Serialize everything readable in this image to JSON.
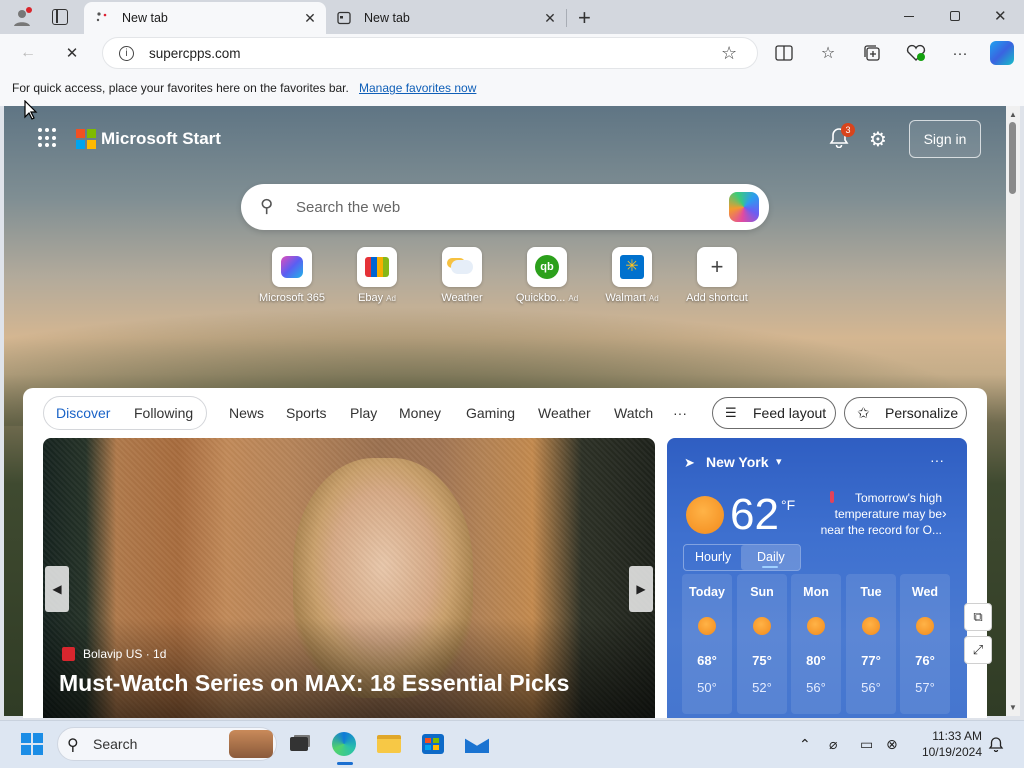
{
  "browser": {
    "tabs": [
      {
        "title": "New tab",
        "active": true
      },
      {
        "title": "New tab",
        "active": false
      }
    ],
    "address": "supercpps.com",
    "favorites_message": "For quick access, place your favorites here on the favorites bar.",
    "favorites_link": "Manage favorites now"
  },
  "start": {
    "brand": "Microsoft Start",
    "notification_count": "3",
    "sign_in": "Sign in",
    "search_placeholder": "Search the web",
    "shortcuts": [
      {
        "label": "Microsoft 365",
        "ad": "",
        "icon": "microsoft365-icon"
      },
      {
        "label": "Ebay",
        "ad": "Ad",
        "icon": "ebay-icon"
      },
      {
        "label": "Weather",
        "ad": "",
        "icon": "weather-icon"
      },
      {
        "label": "Quickbo...",
        "ad": "Ad",
        "icon": "quickbooks-icon"
      },
      {
        "label": "Walmart",
        "ad": "Ad",
        "icon": "walmart-icon"
      },
      {
        "label": "Add shortcut",
        "ad": "",
        "icon": "plus-icon"
      }
    ]
  },
  "feed": {
    "pill_tabs": [
      "Discover",
      "Following"
    ],
    "nav": [
      "News",
      "Sports",
      "Play",
      "Money",
      "Gaming",
      "Weather",
      "Watch",
      "···"
    ],
    "feed_layout": "Feed layout",
    "personalize": "Personalize",
    "hero": {
      "source": "Bolavip US · 1d",
      "headline": "Must-Watch Series on MAX: 18 Essential Picks"
    }
  },
  "weather": {
    "city": "New York",
    "temp": "62",
    "unit": "°F",
    "alert": "Tomorrow's high temperature may be near the record for O...",
    "tabs": [
      "Hourly",
      "Daily"
    ],
    "days": [
      {
        "name": "Today",
        "hi": "68°",
        "lo": "50°"
      },
      {
        "name": "Sun",
        "hi": "75°",
        "lo": "52°"
      },
      {
        "name": "Mon",
        "hi": "80°",
        "lo": "56°"
      },
      {
        "name": "Tue",
        "hi": "77°",
        "lo": "56°"
      },
      {
        "name": "Wed",
        "hi": "76°",
        "lo": "57°"
      }
    ]
  },
  "taskbar": {
    "search": "Search",
    "time": "11:33 AM",
    "date": "10/19/2024"
  },
  "colors": {
    "accent": "#1a63c7",
    "weather_bg": "#3e70cf",
    "notification_badge": "#d9441c"
  }
}
